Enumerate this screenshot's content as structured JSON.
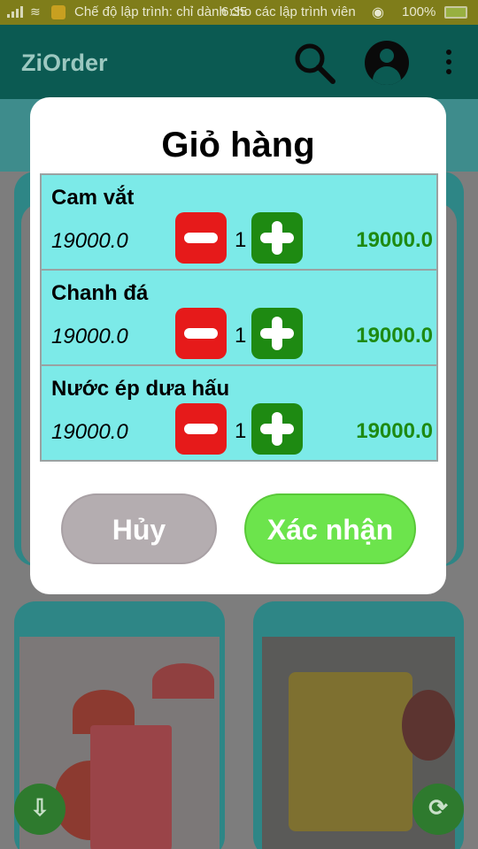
{
  "status_bar": {
    "notification": "Chế độ lập trình: chỉ dành cho các lập trình viên",
    "time": "6:35",
    "battery": "100%"
  },
  "app_bar": {
    "title": "ZiOrder",
    "icons": [
      "search-icon",
      "account-icon",
      "more-vert-icon"
    ]
  },
  "dialog": {
    "title": "Giỏ hàng",
    "items": [
      {
        "name": "Cam vắt",
        "price": "19000.0",
        "quantity": "1",
        "total": "19000.0"
      },
      {
        "name": "Chanh đá",
        "price": "19000.0",
        "quantity": "1",
        "total": "19000.0"
      },
      {
        "name": "Nước ép dưa hấu",
        "price": "19000.0",
        "quantity": "1",
        "total": "19000.0"
      }
    ],
    "cancel_label": "Hủy",
    "confirm_label": "Xác nhận"
  },
  "colors": {
    "app_bar": "#0b5a52",
    "list_bg": "#7ceae8",
    "minus": "#e61a1a",
    "plus": "#1e8a12",
    "confirm": "#6ce44c",
    "cancel": "#b4adb0"
  }
}
